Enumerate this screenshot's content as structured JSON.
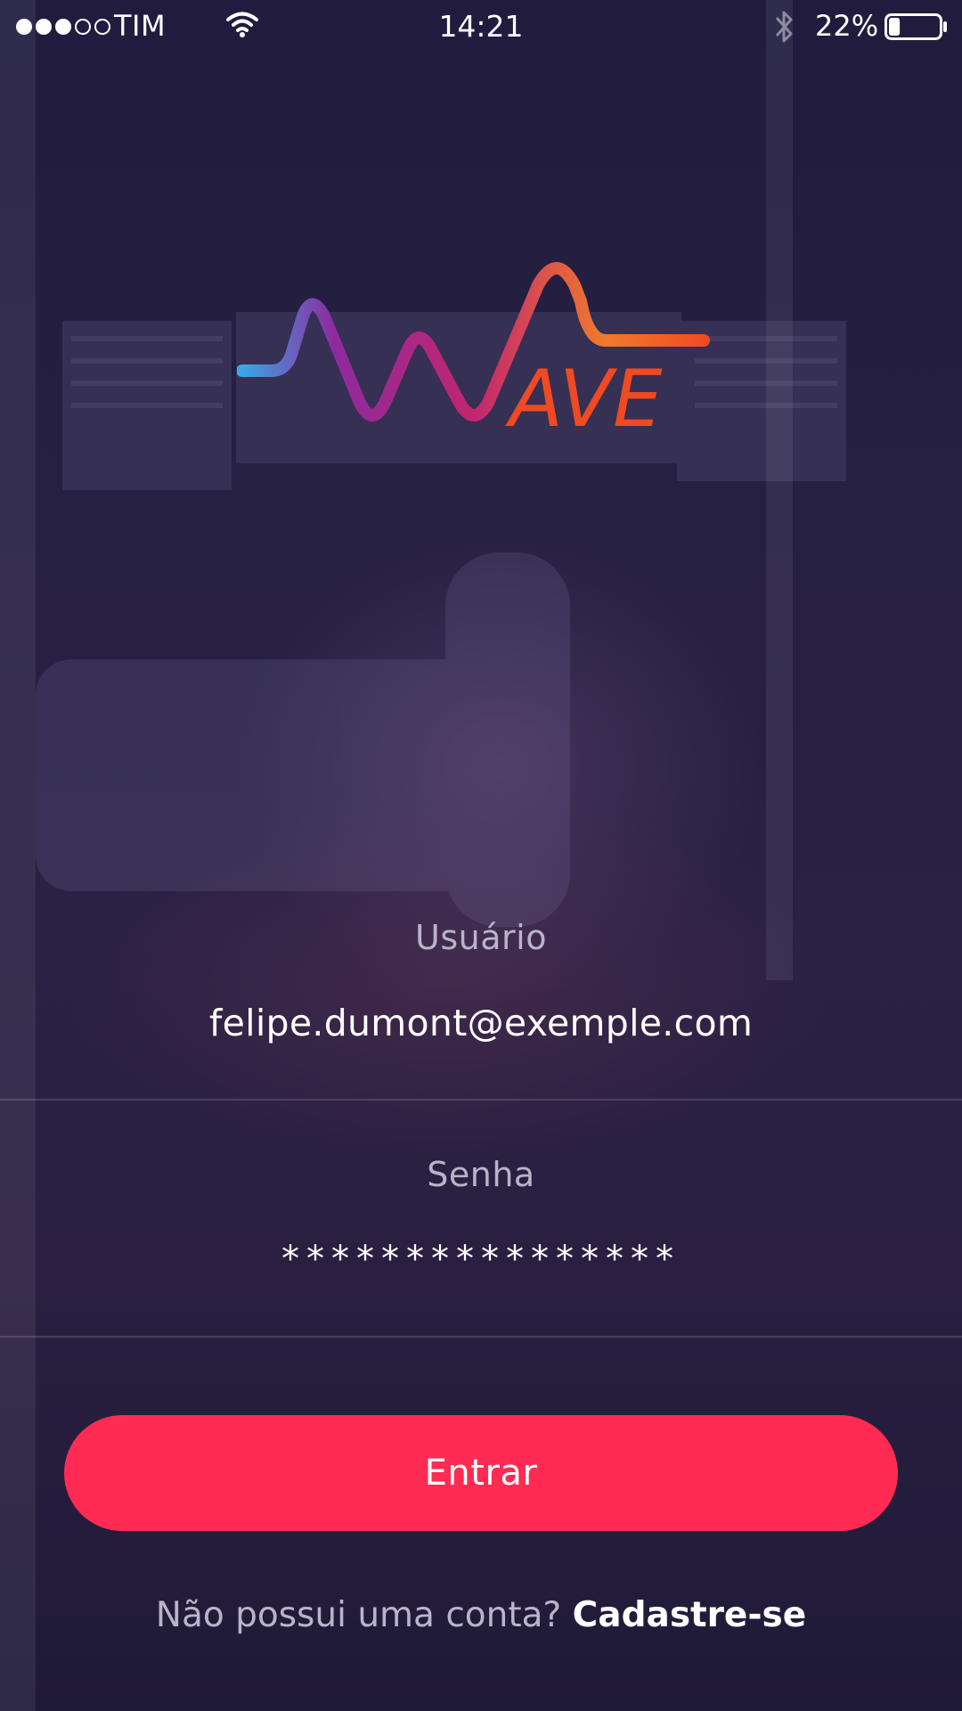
{
  "status_bar": {
    "signal_dots_full": 3,
    "signal_dots_total": 5,
    "carrier": "TIM",
    "time": "14:21",
    "battery_percent": "22%",
    "battery_level": 0.22,
    "icons": [
      "wifi-icon",
      "bluetooth-icon",
      "battery-icon"
    ]
  },
  "logo": {
    "text": "AVE",
    "colors": [
      "#3aa8e8",
      "#8e2a9e",
      "#c2266e",
      "#f07a2c",
      "#f04a22"
    ]
  },
  "form": {
    "username_label": "Usuário",
    "username_value": "felipe.dumont@exemple.com",
    "password_label": "Senha",
    "password_value": "****************"
  },
  "login_button": {
    "label": "Entrar",
    "color": "#ff2b53"
  },
  "signup": {
    "prompt": "Não possui uma conta?",
    "link": "Cadastre-se"
  }
}
